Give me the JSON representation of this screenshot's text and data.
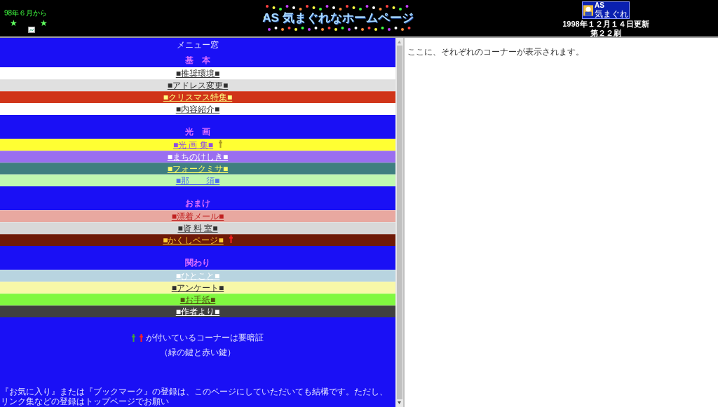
{
  "header": {
    "since": "98年６月から",
    "stars": [
      "★",
      "★"
    ],
    "logo": "AS 気まぐれなホームページ",
    "badge": [
      "AS",
      "気まぐれ"
    ],
    "updated": "1998年１２月１４日更新",
    "edition": "第２２刷"
  },
  "menu": {
    "title": "メニュー窓",
    "sections": [
      {
        "heading": "基　本",
        "items": [
          {
            "label": "■推奨環境■",
            "color": "#ffffff"
          },
          {
            "label": "■アドレス変更■",
            "color": "#e0e0e0"
          },
          {
            "label": "■クリスマス特集■",
            "color": "#d03418"
          },
          {
            "label": "■内容紹介■",
            "color": "#fefefe"
          }
        ]
      },
      {
        "heading": "光　画",
        "items": [
          {
            "label": "■光 画 集■",
            "color": "#ffff33",
            "key": {
              "color": "#b0a020"
            }
          },
          {
            "label": "■まちのけしき■",
            "color": "#9a6ef0"
          },
          {
            "label": "■フォークミサ■",
            "color": "#3f7f80"
          },
          {
            "label": "■那　　須■",
            "color": "#c0f8b0"
          }
        ]
      },
      {
        "heading": "おまけ",
        "items": [
          {
            "label": "■漂着メール■",
            "color": "#e8a8a0"
          },
          {
            "label": "■資 料 室■",
            "color": "#d8d8d8"
          },
          {
            "label": "■かくしページ■",
            "color": "#6e1a08",
            "key": {
              "color": "#ff2020"
            }
          }
        ]
      },
      {
        "heading": "関わり",
        "items": [
          {
            "label": "■ひとこと■",
            "color": "#b8d4e0"
          },
          {
            "label": "■アンケート■",
            "color": "#f8f8a8"
          },
          {
            "label": "■お手紙■",
            "color": "#80f840"
          },
          {
            "label": "■作者より■",
            "color": "#404040"
          }
        ]
      }
    ],
    "note_keys": [
      {
        "color": "#40a040"
      },
      {
        "color": "#ff2020"
      }
    ],
    "note": "が付いているコーナーは要暗証",
    "note_sub": "（緑の鍵と赤い鍵）",
    "footer": "『お気に入り』または『ブックマーク』の登録は、このページにしていただいても結構です。ただし、リンク集などの登録はトップページでお願い"
  },
  "content": {
    "text": "ここに、それぞれのコーナーが表示されます。"
  }
}
